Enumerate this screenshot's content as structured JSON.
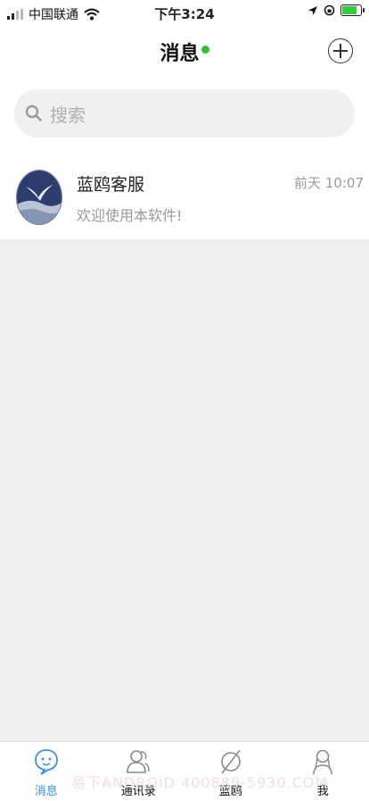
{
  "status_bar": {
    "carrier": "中国联通",
    "time": "下午3:24",
    "battery_level": 0.9
  },
  "header": {
    "title": "消息",
    "online_color": "#2ec134",
    "add_icon": "plus-circle-icon"
  },
  "search": {
    "placeholder": "搜索",
    "icon": "search-icon"
  },
  "conversations": [
    {
      "name": "蓝鸥客服",
      "time": "前天 10:07",
      "message": "欢迎使用本软件!",
      "avatar_icon": "seagull-logo"
    }
  ],
  "tabs": [
    {
      "label": "消息",
      "icon": "chat-bubble-icon",
      "active": true
    },
    {
      "label": "通讯录",
      "icon": "contacts-icon",
      "active": false
    },
    {
      "label": "蓝鸥",
      "icon": "discover-slash-icon",
      "active": false
    },
    {
      "label": "我",
      "icon": "profile-icon",
      "active": false
    }
  ],
  "watermark": "易下ANDROID 400889-5930.COM",
  "colors": {
    "accent": "#3a8ee6",
    "background": "#efefef"
  }
}
